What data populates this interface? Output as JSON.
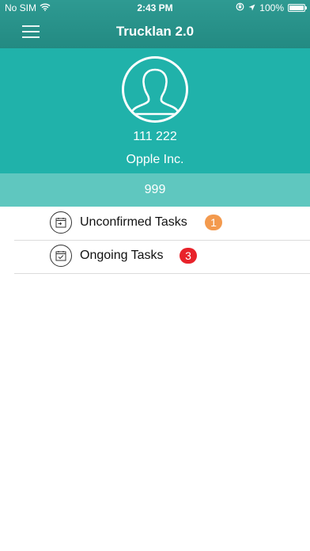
{
  "status_bar": {
    "carrier": "No SIM",
    "time": "2:43 PM",
    "battery": "100%"
  },
  "nav": {
    "title": "Trucklan 2.0",
    "menu_icon": "hamburger-icon"
  },
  "profile": {
    "avatar_icon": "user-silhouette-icon",
    "phone": "111 222",
    "company": "Opple Inc.",
    "id": "999"
  },
  "tasks": [
    {
      "label": "Unconfirmed Tasks",
      "icon": "calendar-forward-icon",
      "count": "1",
      "badge_color": "#f39a4e"
    },
    {
      "label": "Ongoing Tasks",
      "icon": "calendar-check-icon",
      "count": "3",
      "badge_color": "#e8222a"
    }
  ],
  "colors": {
    "nav_bar": "#238a82",
    "profile_bg": "#20b2aa",
    "id_bar": "#5fc7bf"
  }
}
